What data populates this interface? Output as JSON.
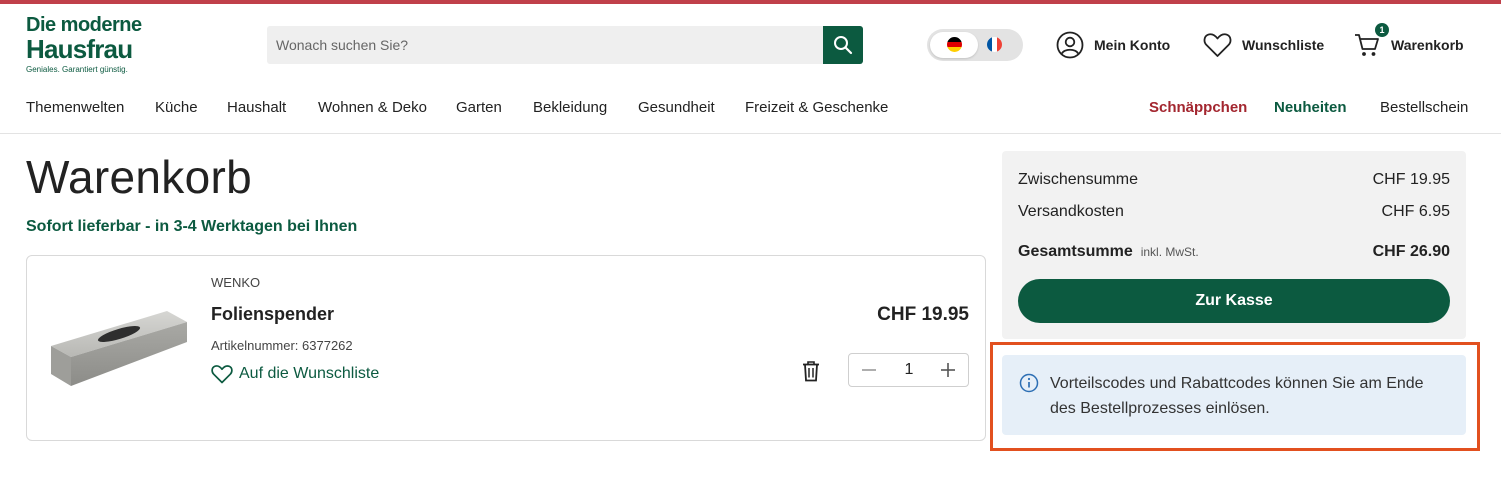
{
  "brand": {
    "line1": "Die moderne",
    "line2": "Hausfrau",
    "tagline": "Geniales. Garantiert günstig."
  },
  "search": {
    "placeholder": "Wonach suchen Sie?",
    "icon": "search-icon"
  },
  "languages": [
    "de",
    "fr"
  ],
  "header": {
    "account": "Mein Konto",
    "wishlist": "Wunschliste",
    "cart": "Warenkorb",
    "cart_count": "1"
  },
  "nav": {
    "items": [
      "Themenwelten",
      "Küche",
      "Haushalt",
      "Wohnen & Deko",
      "Garten",
      "Bekleidung",
      "Gesundheit",
      "Freizeit & Geschenke"
    ],
    "deals": "Schnäppchen",
    "new": "Neuheiten",
    "order_form": "Bestellschein"
  },
  "page": {
    "title": "Warenkorb",
    "delivery": "Sofort lieferbar - in 3-4 Werktagen bei Ihnen"
  },
  "item": {
    "brand": "WENKO",
    "name": "Folienspender",
    "article": "Artikelnummer: 6377262",
    "wishlist_link": "Auf die Wunschliste",
    "price": "CHF 19.95",
    "quantity": "1"
  },
  "summary": {
    "subtotal_label": "Zwischensumme",
    "subtotal_value": "CHF 19.95",
    "shipping_label": "Versandkosten",
    "shipping_value": "CHF 6.95",
    "total_label": "Gesamtsumme",
    "total_note": "inkl. MwSt.",
    "total_value": "CHF 26.90",
    "checkout_label": "Zur Kasse"
  },
  "info": {
    "text": "Vorteilscodes und Rabattcodes können Sie am Ende des Bestellprozesses einlösen."
  },
  "colors": {
    "brand_green": "#0c5a40",
    "deal_red": "#a3262f",
    "highlight": "#e2501f",
    "info_bg": "#e6eff8"
  }
}
